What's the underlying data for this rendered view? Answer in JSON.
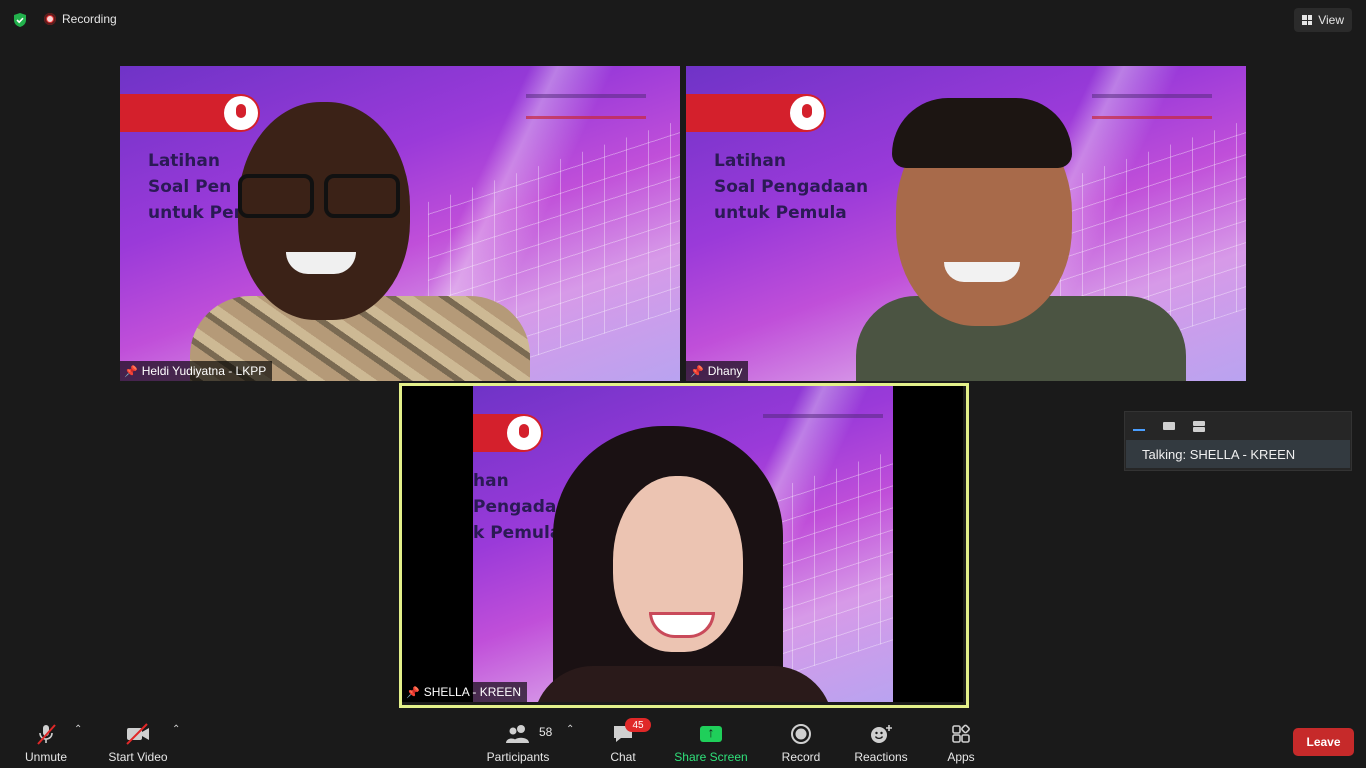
{
  "topbar": {
    "recording_label": "Recording",
    "view_label": "View"
  },
  "tiles": [
    {
      "name": "Heldi Yudiyatna - LKPP",
      "slide_title": "Latihan\nSoal Pen\nuntuk Per"
    },
    {
      "name": "Dhany",
      "slide_title": "Latihan\nSoal Pengadaan\nuntuk Pemula"
    },
    {
      "name": "SHELLA - KREEN",
      "slide_title": "han\nPengadaa\nk Pemula"
    }
  ],
  "talking_panel": {
    "text": "Talking: SHELLA - KREEN"
  },
  "toolbar": {
    "unmute": "Unmute",
    "start_video": "Start Video",
    "participants": "Participants",
    "participants_count": "58",
    "chat": "Chat",
    "chat_badge": "45",
    "share_screen": "Share Screen",
    "record": "Record",
    "reactions": "Reactions",
    "apps": "Apps",
    "leave": "Leave"
  },
  "colors": {
    "active_speaker_border": "#e3f08a",
    "share_green": "#2fe07a",
    "leave_red": "#c62a2a"
  }
}
